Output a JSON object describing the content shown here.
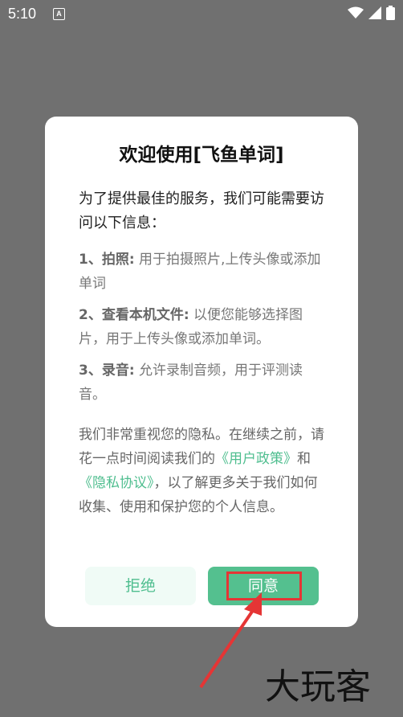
{
  "status_bar": {
    "time": "5:10",
    "notification_letter": "A"
  },
  "dialog": {
    "title": "欢迎使用[飞鱼单词]",
    "intro": "为了提供最佳的服务，我们可能需要访问以下信息：",
    "permissions": [
      {
        "name": "1、拍照:",
        "desc": " 用于拍摄照片,上传头像或添加单词"
      },
      {
        "name": "2、查看本机文件:",
        "desc": " 以便您能够选择图片，用于上传头像或添加单词。"
      },
      {
        "name": "3、录音:",
        "desc": " 允许录制音频，用于评测读音。"
      }
    ],
    "privacy": {
      "prefix": "我们非常重视您的隐私。在继续之前，请花一点时间阅读我们的",
      "link_user_policy": "《用户政策》",
      "and": "和",
      "link_privacy_agreement": "《隐私协议》",
      "suffix": "，以了解更多关于我们如何收集、使用和保护您的个人信息。"
    },
    "buttons": {
      "refuse": "拒绝",
      "agree": "同意"
    }
  },
  "watermark": "大玩客",
  "colors": {
    "accent": "#54c08f",
    "link": "#4fbe8f",
    "highlight": "#e53535",
    "overlay": "#707070"
  }
}
